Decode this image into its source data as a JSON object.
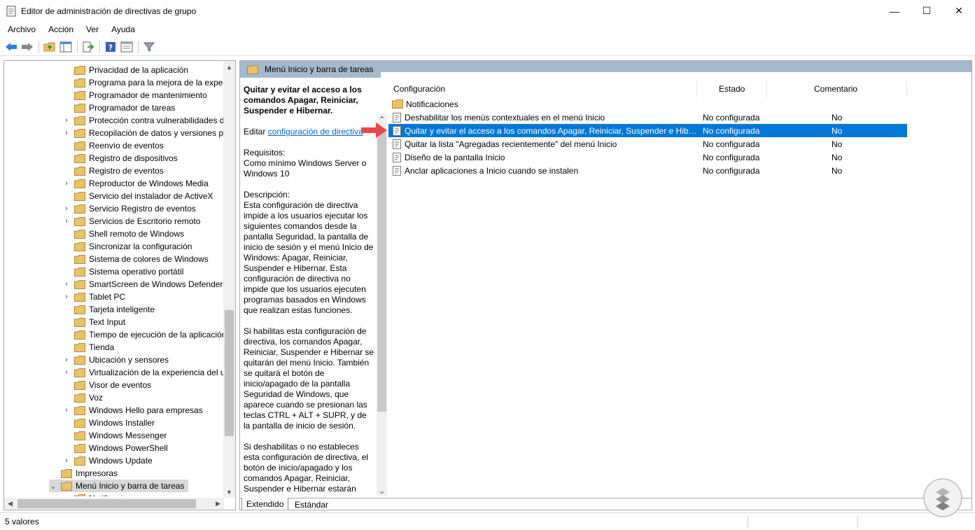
{
  "window": {
    "title": "Editor de administración de directivas de grupo",
    "minimize": "—",
    "maximize": "☐",
    "close": "✕"
  },
  "menu": [
    "Archivo",
    "Acción",
    "Ver",
    "Ayuda"
  ],
  "tree": {
    "items": [
      {
        "label": "Privacidad de la aplicación",
        "expandable": false
      },
      {
        "label": "Programa para la mejora de la experi",
        "expandable": false
      },
      {
        "label": "Programador de mantenimiento",
        "expandable": false
      },
      {
        "label": "Programador de tareas",
        "expandable": false
      },
      {
        "label": "Protección contra vulnerabilidades d",
        "expandable": true
      },
      {
        "label": "Recopilación de datos y versiones pr",
        "expandable": true
      },
      {
        "label": "Reenvío de eventos",
        "expandable": false
      },
      {
        "label": "Registro de dispositivos",
        "expandable": false
      },
      {
        "label": "Registro de eventos",
        "expandable": false
      },
      {
        "label": "Reproductor de Windows Media",
        "expandable": true
      },
      {
        "label": "Servicio del instalador de ActiveX",
        "expandable": false
      },
      {
        "label": "Servicio Registro de eventos",
        "expandable": true
      },
      {
        "label": "Servicios de Escritorio remoto",
        "expandable": true
      },
      {
        "label": "Shell remoto de Windows",
        "expandable": false
      },
      {
        "label": "Sincronizar la configuración",
        "expandable": false
      },
      {
        "label": "Sistema de colores de Windows",
        "expandable": false
      },
      {
        "label": "Sistema operativo portátil",
        "expandable": false
      },
      {
        "label": "SmartScreen de Windows Defender",
        "expandable": true
      },
      {
        "label": "Tablet PC",
        "expandable": true
      },
      {
        "label": "Tarjeta inteligente",
        "expandable": false
      },
      {
        "label": "Text Input",
        "expandable": false
      },
      {
        "label": "Tiempo de ejecución de la aplicación",
        "expandable": false
      },
      {
        "label": "Tienda",
        "expandable": false
      },
      {
        "label": "Ubicación y sensores",
        "expandable": true
      },
      {
        "label": "Virtualización de la experiencia del us",
        "expandable": true
      },
      {
        "label": "Visor de eventos",
        "expandable": false
      },
      {
        "label": "Voz",
        "expandable": false
      },
      {
        "label": "Windows Hello para empresas",
        "expandable": true
      },
      {
        "label": "Windows Installer",
        "expandable": false
      },
      {
        "label": "Windows Messenger",
        "expandable": false
      },
      {
        "label": "Windows PowerShell",
        "expandable": false
      },
      {
        "label": "Windows Update",
        "expandable": true
      }
    ],
    "parent_items": [
      {
        "label": "Impresoras",
        "expanded": false
      },
      {
        "label": "Menú Inicio y barra de tareas",
        "expanded": true,
        "selected": true
      },
      {
        "label": "Notificaciones",
        "expanded": false
      }
    ]
  },
  "header": {
    "title": "Menú Inicio y barra de tareas"
  },
  "description": {
    "title": "Quitar y evitar el acceso a los comandos Apagar, Reiniciar, Suspender e Hibernar.",
    "edit_prefix": "Editar ",
    "edit_link": "configuración de directiva",
    "requirements_label": "Requisitos:",
    "requirements": "Como mínimo Windows Server o Windows 10",
    "description_label": "Descripción:",
    "paragraph1": "Esta configuración de directiva impide a los usuarios ejecutar los siguientes comandos desde la pantalla Seguridad, la pantalla de inicio de sesión y el menú Inicio de Windows: Apagar, Reiniciar, Suspender e Hibernar. Esta configuración de directiva no impide que los usuarios ejecuten programas basados en Windows que realizan estas funciones.",
    "paragraph2": "Si habilitas esta configuración de directiva, los comandos Apagar, Reiniciar, Suspender e Hibernar se quitarán del menú Inicio. También se quitará el botón de inicio/apagado de la pantalla Seguridad de Windows, que aparece cuando se presionan las teclas CTRL + ALT + SUPR, y de la pantalla de inicio de sesión.",
    "paragraph3": "Si deshabilitas o no estableces esta configuración de directiva, el botón de inicio/apagado y los comandos Apagar, Reiniciar, Suspender e Hibernar estarán"
  },
  "list": {
    "columns": [
      "Configuración",
      "Estado",
      "Comentario"
    ],
    "folder": "Notificaciones",
    "rows": [
      {
        "name": "Deshabilitar los menús contextuales en el menú Inicio",
        "state": "No configurada",
        "comment": "No"
      },
      {
        "name": "Quitar y evitar el acceso a los comandos Apagar, Reiniciar, Suspender e Hibernar",
        "state": "No configurada",
        "comment": "No",
        "selected": true
      },
      {
        "name": "Quitar la lista \"Agregadas recientemente\" del menú Inicio",
        "state": "No configurada",
        "comment": "No"
      },
      {
        "name": "Diseño de la pantalla Inicio",
        "state": "No configurada",
        "comment": "No"
      },
      {
        "name": "Anclar aplicaciones a Inicio cuando se instalen",
        "state": "No configurada",
        "comment": "No"
      }
    ]
  },
  "tabs": [
    "Extendido",
    "Estándar"
  ],
  "status": {
    "text": "5 valores"
  },
  "colors": {
    "header": "#a5b9cd",
    "selection": "#0078d7",
    "folder": "#e8c26c",
    "arrow": "#e8484a"
  },
  "icons": [
    "back-icon",
    "forward-icon",
    "up-folder-icon",
    "show-tree-icon",
    "export-icon",
    "help-icon",
    "properties-icon",
    "filter-icon"
  ]
}
